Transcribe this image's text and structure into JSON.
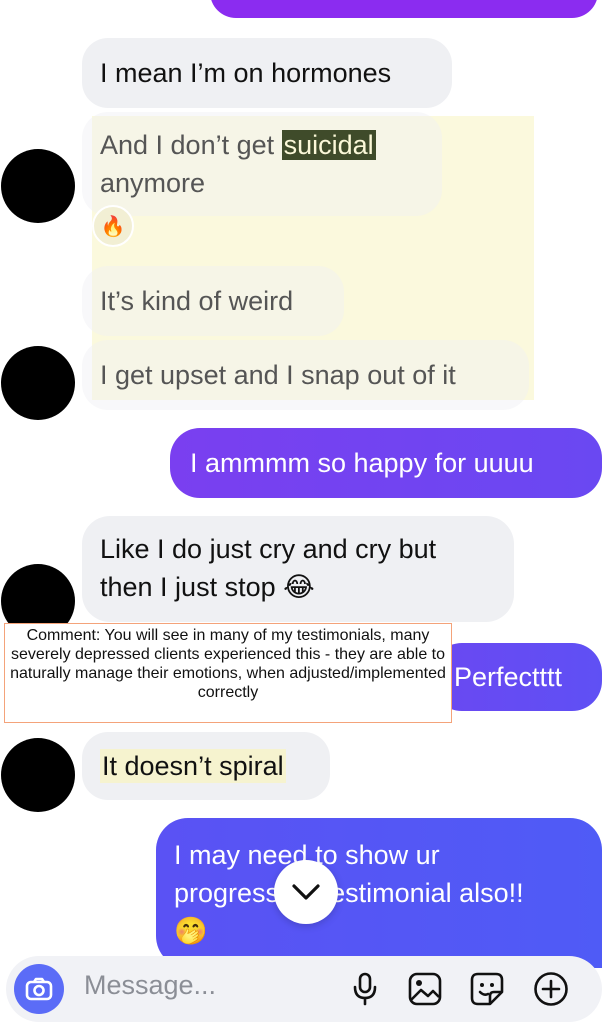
{
  "messages": {
    "m1": "I mean I’m on hormones",
    "m2_before": "And I don’t get ",
    "m2_highlight": "suicidal",
    "m2_after": "anymore",
    "m2_reaction": "🔥",
    "m3": "It’s kind of weird",
    "m4": "I get upset and I snap out of it",
    "m5": "I ammmm so happy for uuuu",
    "m6_line1": "Like I do just cry and cry but",
    "m6_line2": "then I just stop 😂",
    "m7": "Perfectttt",
    "m8": "It doesn’t spiral",
    "m9_line1": "I may need to show ur",
    "m9_line2": "progress as testimonial also!!",
    "m9_line3": "🤭"
  },
  "comment": {
    "text": "Comment: You will see in many of my testimonials, many severely depressed clients experienced this - they are able to naturally manage their emotions, when adjusted/implemented correctly"
  },
  "composer": {
    "placeholder": "Message..."
  },
  "icons": {
    "camera": "camera-icon",
    "mic": "microphone-icon",
    "gallery": "gallery-icon",
    "sticker": "sticker-icon",
    "plus": "plus-circle-icon",
    "scroll": "chevron-down-icon"
  },
  "colors": {
    "outgoing_start": "#7a3ff0",
    "outgoing_end": "#5a55f4",
    "incoming": "#eff0f3",
    "highlight": "#fbf8d8",
    "accent": "#5b6cf7"
  }
}
